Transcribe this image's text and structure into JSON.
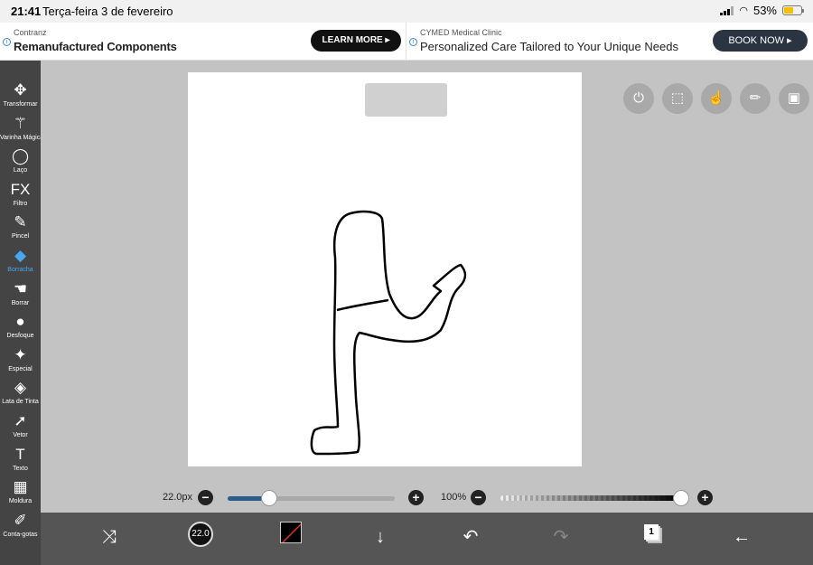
{
  "status": {
    "time": "21:41",
    "date": "Terça-feira 3 de fevereiro",
    "battery": "53%",
    "battery_level": 0.53
  },
  "ads": [
    {
      "sponsor": "Contranz",
      "headline": "Remanufactured Components",
      "cta": "LEARN MORE ▸"
    },
    {
      "sponsor": "CYMED Medical Clinic",
      "headline": "Personalized Care Tailored to Your Unique Needs",
      "cta": "BOOK NOW ▸"
    }
  ],
  "tools": [
    {
      "id": "transform",
      "label": "Transformar",
      "icon": "✥"
    },
    {
      "id": "magic-wand",
      "label": "Varinha Mágica",
      "icon": "⚚"
    },
    {
      "id": "lasso",
      "label": "Laço",
      "icon": "◯"
    },
    {
      "id": "filter",
      "label": "Filtro",
      "icon": "FX"
    },
    {
      "id": "brush",
      "label": "Pincel",
      "icon": "✎"
    },
    {
      "id": "eraser",
      "label": "Borracha",
      "icon": "◆",
      "active": true
    },
    {
      "id": "smudge",
      "label": "Borrar",
      "icon": "☚"
    },
    {
      "id": "blur",
      "label": "Desfoque",
      "icon": "●"
    },
    {
      "id": "special",
      "label": "Especial",
      "icon": "✦"
    },
    {
      "id": "bucket",
      "label": "Lata de Tinta",
      "icon": "◈"
    },
    {
      "id": "vector",
      "label": "Vetor",
      "icon": "➚"
    },
    {
      "id": "text",
      "label": "Texto",
      "icon": "T"
    },
    {
      "id": "frame",
      "label": "Moldura",
      "icon": "▦"
    },
    {
      "id": "eyedropper",
      "label": "Conta-gotas",
      "icon": "✐"
    }
  ],
  "top_buttons": [
    {
      "id": "toggle",
      "icon": "toggle-icon",
      "glyph": "⏻"
    },
    {
      "id": "selection",
      "icon": "selection-icon",
      "glyph": "⬚"
    },
    {
      "id": "touch",
      "icon": "hand-icon",
      "glyph": "☝"
    },
    {
      "id": "ruler",
      "icon": "ruler-icon",
      "glyph": "✏"
    },
    {
      "id": "image",
      "icon": "image-icon",
      "glyph": "▣"
    }
  ],
  "brush": {
    "size_label": "22.0px",
    "size_fraction": 0.25,
    "minus": "−",
    "plus": "+",
    "circle_label": "22.0"
  },
  "opacity": {
    "label": "100%",
    "fraction": 1.0,
    "minus": "−",
    "plus": "+"
  },
  "bottom": {
    "layers_count": "1",
    "transform_glyph": "⤨",
    "download_glyph": "↓",
    "undo_glyph": "↶",
    "redo_glyph": "↷",
    "back_glyph": "←"
  },
  "colors": {
    "accent": "#49a6f0",
    "panel": "#444444",
    "bottombar": "#555555",
    "canvas_bg": "#c3c3c3"
  }
}
